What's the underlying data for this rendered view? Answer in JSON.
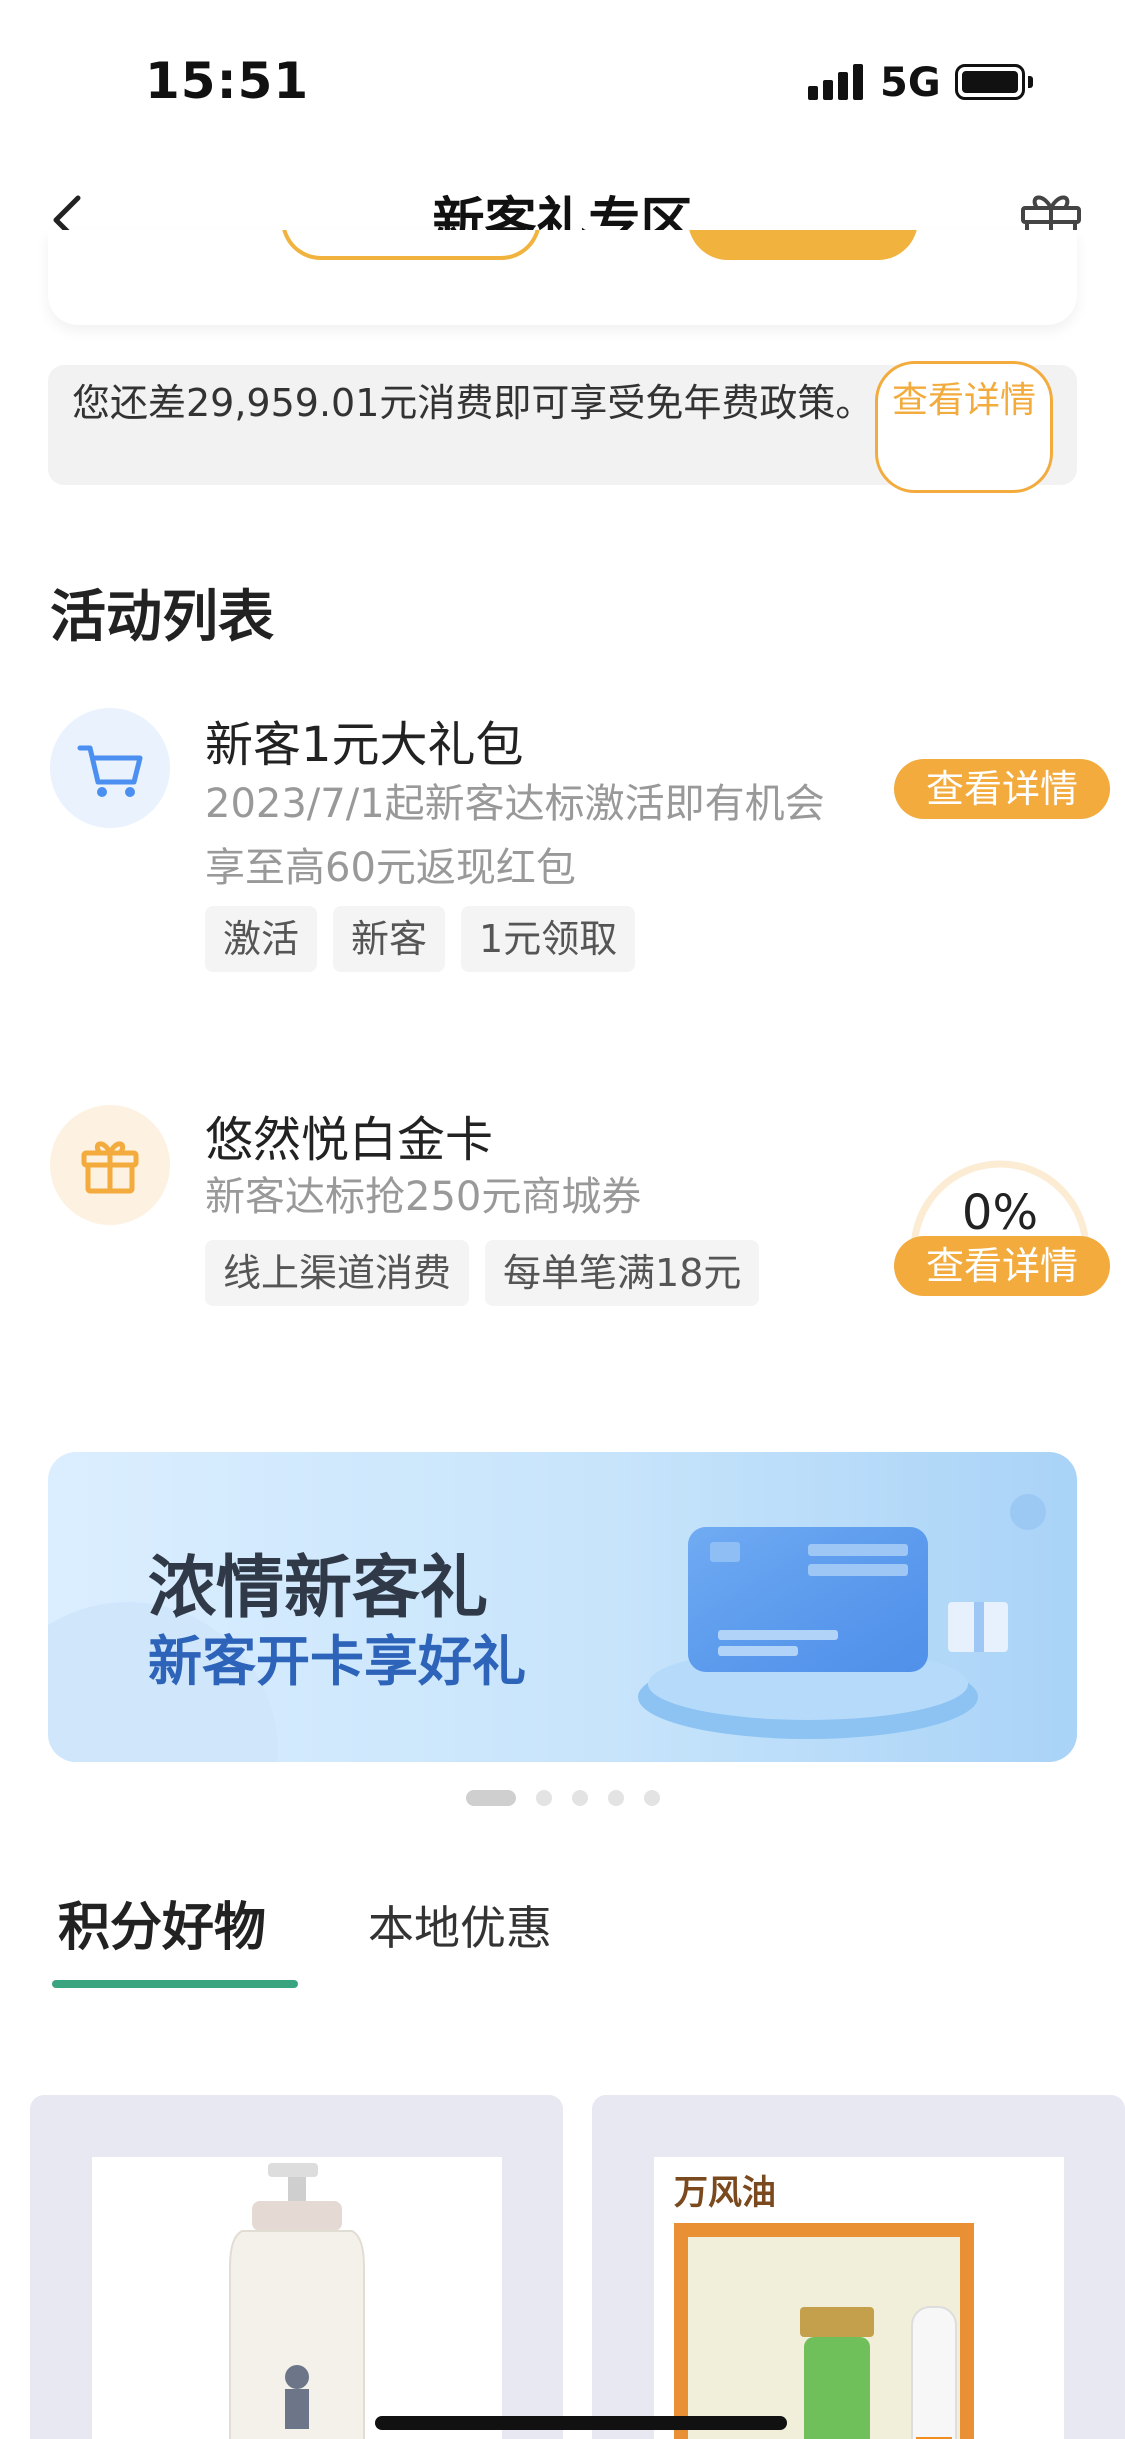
{
  "status": {
    "time": "15:51",
    "network": "5G"
  },
  "nav": {
    "title": "新客礼专区"
  },
  "notice": {
    "text": "您还差29,959.01元消费即可享受免年费政策。",
    "button": "查看详情"
  },
  "activities": {
    "title": "活动列表",
    "items": [
      {
        "title": "新客1元大礼包",
        "desc": "2023/7/1起新客达标激活即有机会享至高60元返现红包",
        "tags": [
          "激活",
          "新客",
          "1元领取"
        ],
        "button": "查看详情",
        "icon": "cart-icon"
      },
      {
        "title": "悠然悦白金卡",
        "desc": "新客达标抢250元商城券",
        "tags": [
          "线上渠道消费",
          "每单笔满18元"
        ],
        "button": "查看详情",
        "progress": "0%",
        "progress_value": 0,
        "icon": "gift-icon"
      }
    ]
  },
  "banner": {
    "title": "浓情新客礼",
    "subtitle": "新客开卡享好礼",
    "page_count": 5,
    "active_index": 0
  },
  "tabs": [
    {
      "label": "积分好物",
      "active": true
    },
    {
      "label": "本地优惠",
      "active": false
    }
  ],
  "products": [
    {
      "name": "shampoo-bottle"
    },
    {
      "name": "万风油",
      "label": "万风油"
    }
  ],
  "colors": {
    "accent": "#f2ab3c",
    "tab_underline": "#3aa47f",
    "banner_sub": "#2d63b8"
  }
}
